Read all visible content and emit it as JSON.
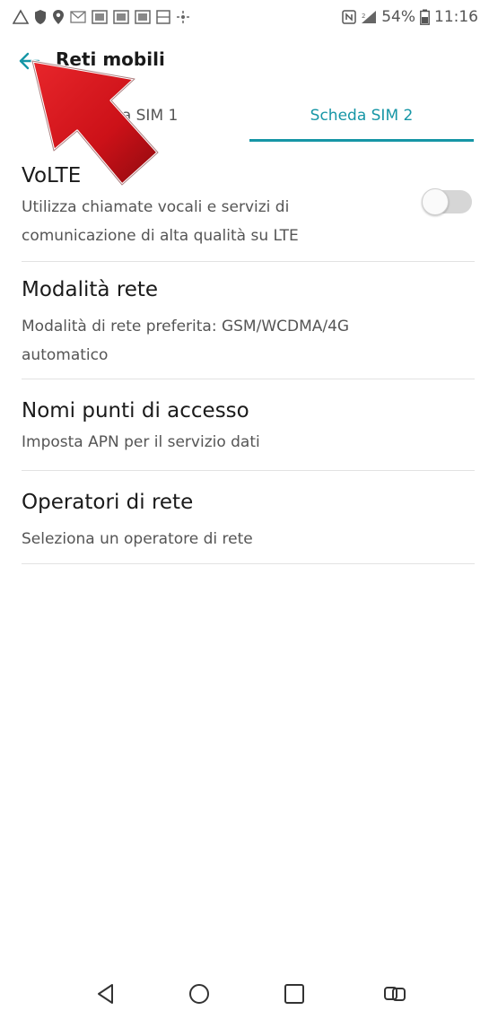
{
  "status_bar": {
    "battery_percent": "54%",
    "time": "11:16"
  },
  "app_bar": {
    "title": "Reti mobili",
    "back_icon": "arrow-left-icon"
  },
  "tabs": [
    {
      "label": "Scheda SIM 1",
      "selected": false
    },
    {
      "label": "Scheda SIM 2",
      "selected": true
    }
  ],
  "accent_color": "#1696a6",
  "settings": [
    {
      "title": "VoLTE",
      "summary": "Utilizza chiamate vocali e servizi di comunicazione di alta qualità su LTE",
      "toggle_on": false
    },
    {
      "title": "Modalità rete",
      "summary": "Modalità di rete preferita: GSM/WCDMA/4G automatico"
    },
    {
      "title": "Nomi punti di accesso",
      "summary": "Imposta APN per il servizio dati"
    },
    {
      "title": "Operatori di rete",
      "summary": "Seleziona un operatore di rete"
    }
  ],
  "nav_bar": {
    "icons": [
      "back-triangle-icon",
      "home-circle-icon",
      "recents-square-icon",
      "dual-window-icon"
    ]
  },
  "annotation": {
    "type": "red-arrow",
    "color": "#d4141a"
  }
}
